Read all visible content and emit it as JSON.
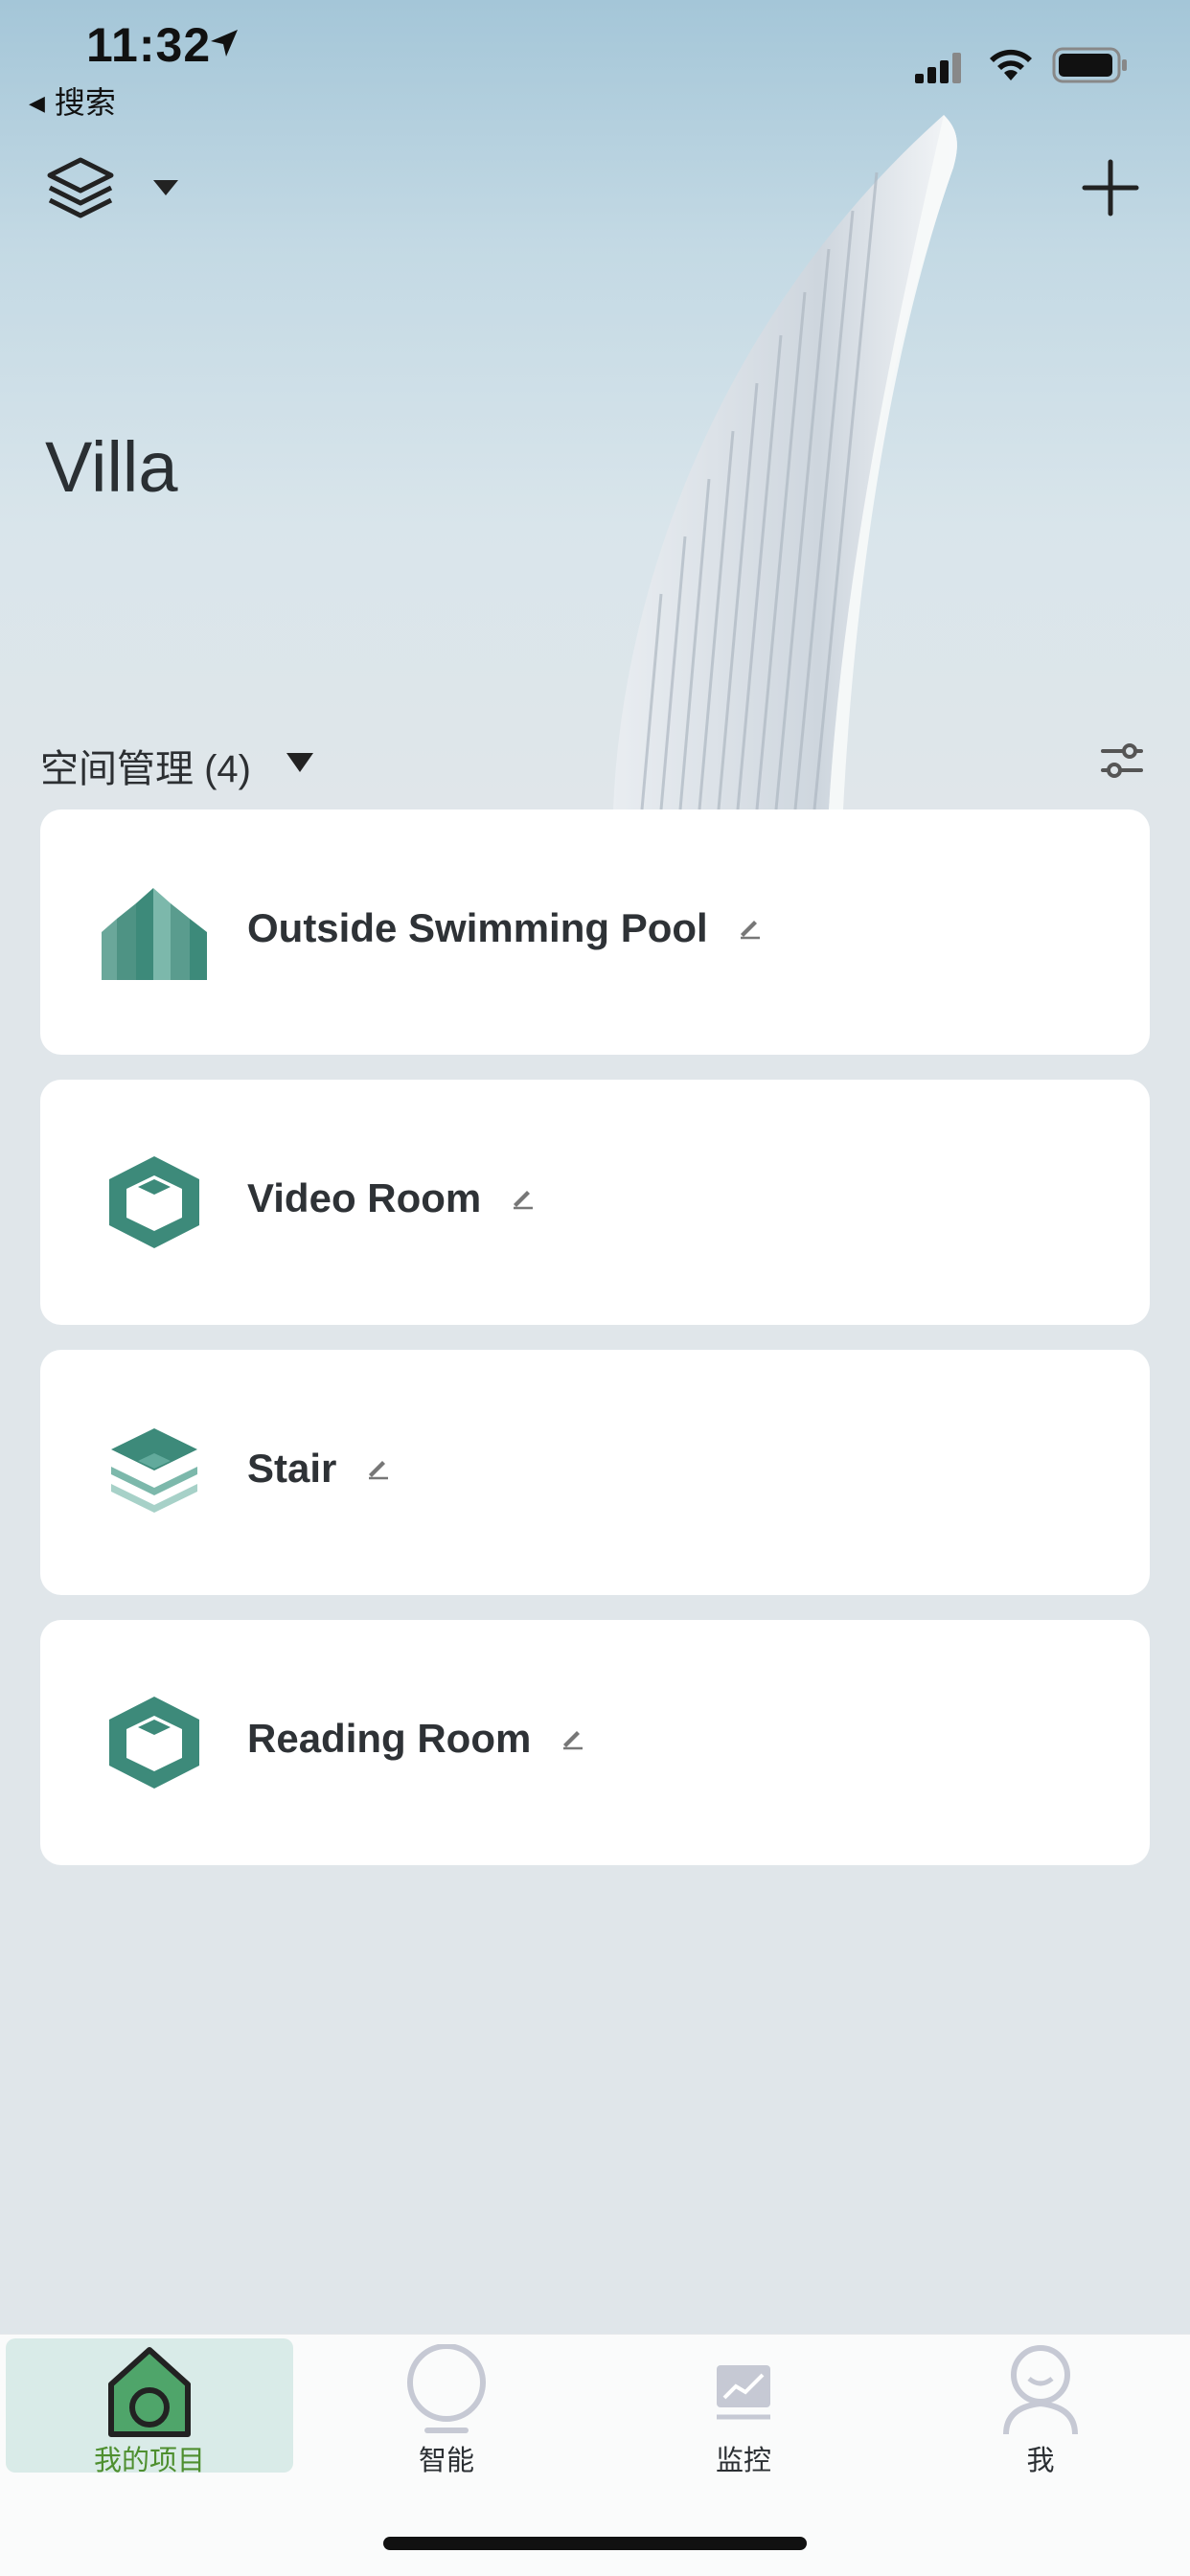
{
  "status_bar": {
    "time": "11:32",
    "back_label": "搜索"
  },
  "header": {
    "title": "Villa"
  },
  "section": {
    "label": "空间管理 (4)"
  },
  "spaces": [
    {
      "name": "Outside Swimming Pool",
      "icon": "building-icon"
    },
    {
      "name": "Video Room",
      "icon": "room-hexagon-icon"
    },
    {
      "name": "Stair",
      "icon": "floor-layers-icon"
    },
    {
      "name": "Reading Room",
      "icon": "room-hexagon-icon"
    }
  ],
  "tabbar": {
    "tabs": [
      {
        "label": "我的项目",
        "icon": "home-icon",
        "active": true
      },
      {
        "label": "智能",
        "icon": "bulb-icon",
        "active": false
      },
      {
        "label": "监控",
        "icon": "chart-icon",
        "active": false
      },
      {
        "label": "我",
        "icon": "user-icon",
        "active": false
      }
    ]
  },
  "colors": {
    "accent_green": "#3d8a7a",
    "active_tab_text": "#4e8f2f",
    "active_tab_bg": "#d9ebe8"
  }
}
